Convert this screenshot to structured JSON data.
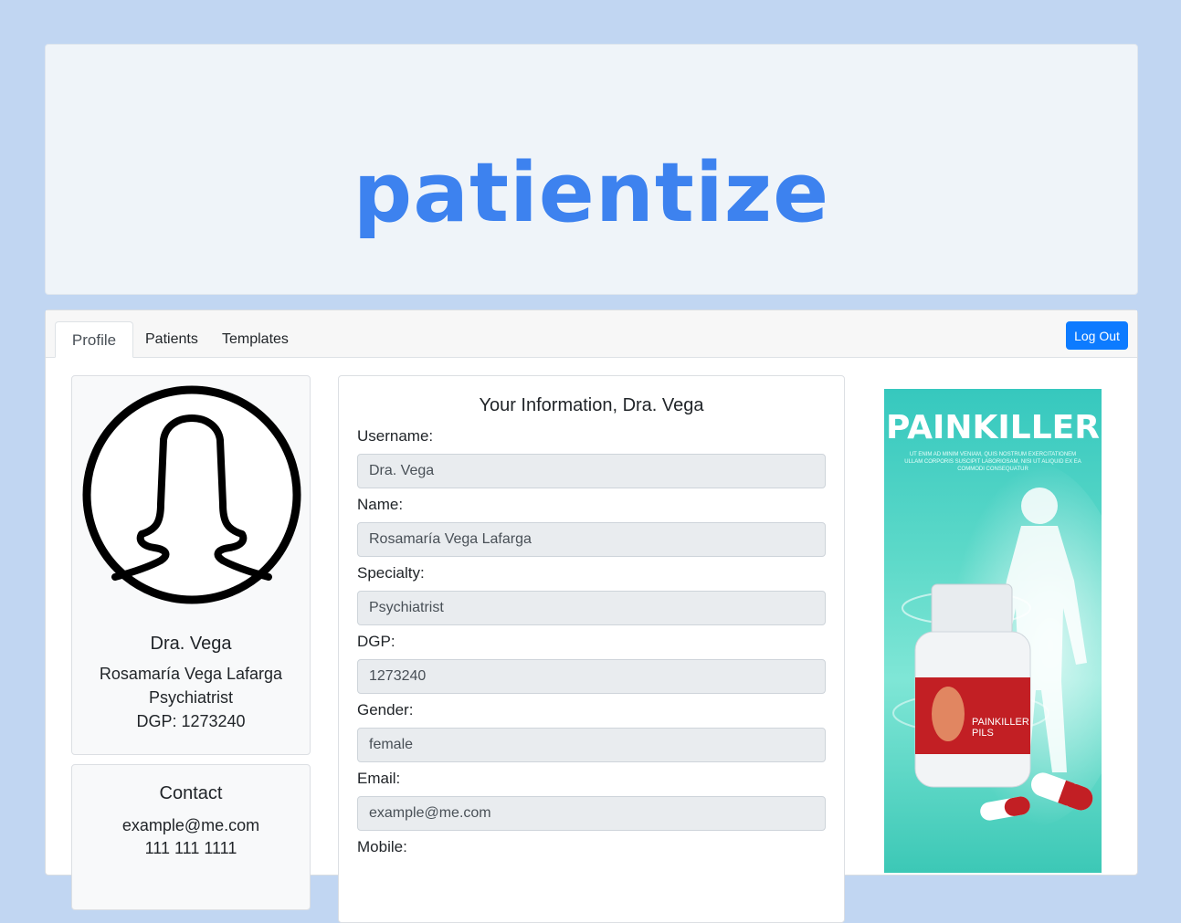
{
  "brand": {
    "logo_text": "patientize",
    "color": "#3d82ef"
  },
  "nav": {
    "tabs": [
      {
        "label": "Profile",
        "active": true
      },
      {
        "label": "Patients",
        "active": false
      },
      {
        "label": "Templates",
        "active": false
      }
    ],
    "logout_label": "Log Out"
  },
  "profile_card": {
    "username": "Dra. Vega",
    "name": "Rosamaría Vega Lafarga",
    "specialty": "Psychiatrist",
    "dgp": "DGP: 1273240",
    "avatar_icon": "female-user-icon"
  },
  "contact_card": {
    "title": "Contact",
    "email": "example@me.com",
    "phone": "111 111 1111"
  },
  "info": {
    "title": "Your Information, Dra. Vega",
    "fields": [
      {
        "label": "Username:",
        "value": "Dra. Vega"
      },
      {
        "label": "Name:",
        "value": "Rosamaría Vega Lafarga"
      },
      {
        "label": "Specialty:",
        "value": "Psychiatrist"
      },
      {
        "label": "DGP:",
        "value": "1273240"
      },
      {
        "label": "Gender:",
        "value": "female"
      },
      {
        "label": "Email:",
        "value": "example@me.com"
      },
      {
        "label": "Mobile:",
        "value": ""
      }
    ]
  },
  "ad": {
    "title": "PAINKILLER",
    "small_text": "UT ENIM AD MINIM VENIAM, QUIS NOSTRUM EXERCITATIONEM ULLAM CORPORIS SUSCIPIT LABORIOSAM, NISI UT ALIQUID EX EA COMMODI CONSEQUATUR",
    "label_line1": "PAINKILLER",
    "label_line2": "PILS"
  }
}
